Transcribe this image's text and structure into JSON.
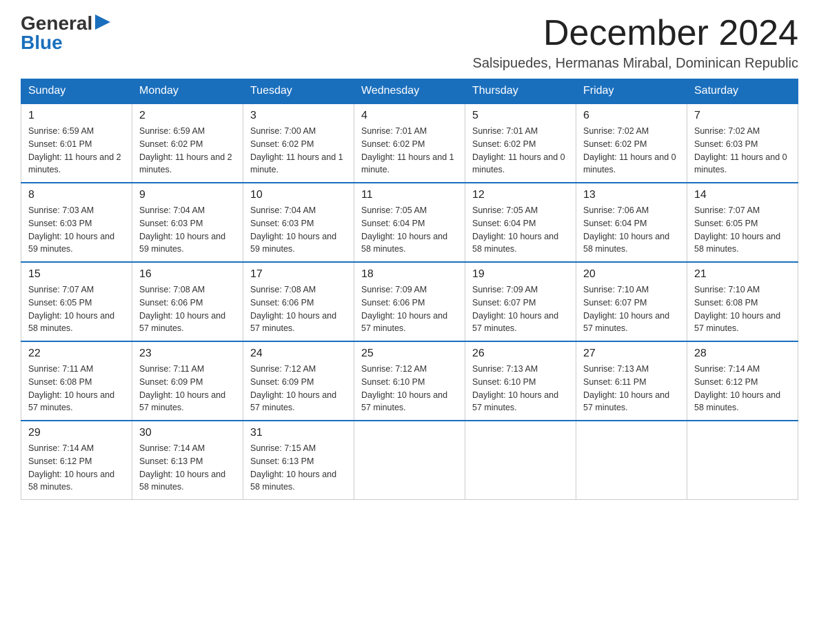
{
  "logo": {
    "general": "General",
    "blue": "Blue",
    "triangle": "▶"
  },
  "title": "December 2024",
  "subtitle": "Salsipuedes, Hermanas Mirabal, Dominican Republic",
  "headers": [
    "Sunday",
    "Monday",
    "Tuesday",
    "Wednesday",
    "Thursday",
    "Friday",
    "Saturday"
  ],
  "weeks": [
    [
      {
        "day": "1",
        "sunrise": "Sunrise: 6:59 AM",
        "sunset": "Sunset: 6:01 PM",
        "daylight": "Daylight: 11 hours and 2 minutes."
      },
      {
        "day": "2",
        "sunrise": "Sunrise: 6:59 AM",
        "sunset": "Sunset: 6:02 PM",
        "daylight": "Daylight: 11 hours and 2 minutes."
      },
      {
        "day": "3",
        "sunrise": "Sunrise: 7:00 AM",
        "sunset": "Sunset: 6:02 PM",
        "daylight": "Daylight: 11 hours and 1 minute."
      },
      {
        "day": "4",
        "sunrise": "Sunrise: 7:01 AM",
        "sunset": "Sunset: 6:02 PM",
        "daylight": "Daylight: 11 hours and 1 minute."
      },
      {
        "day": "5",
        "sunrise": "Sunrise: 7:01 AM",
        "sunset": "Sunset: 6:02 PM",
        "daylight": "Daylight: 11 hours and 0 minutes."
      },
      {
        "day": "6",
        "sunrise": "Sunrise: 7:02 AM",
        "sunset": "Sunset: 6:02 PM",
        "daylight": "Daylight: 11 hours and 0 minutes."
      },
      {
        "day": "7",
        "sunrise": "Sunrise: 7:02 AM",
        "sunset": "Sunset: 6:03 PM",
        "daylight": "Daylight: 11 hours and 0 minutes."
      }
    ],
    [
      {
        "day": "8",
        "sunrise": "Sunrise: 7:03 AM",
        "sunset": "Sunset: 6:03 PM",
        "daylight": "Daylight: 10 hours and 59 minutes."
      },
      {
        "day": "9",
        "sunrise": "Sunrise: 7:04 AM",
        "sunset": "Sunset: 6:03 PM",
        "daylight": "Daylight: 10 hours and 59 minutes."
      },
      {
        "day": "10",
        "sunrise": "Sunrise: 7:04 AM",
        "sunset": "Sunset: 6:03 PM",
        "daylight": "Daylight: 10 hours and 59 minutes."
      },
      {
        "day": "11",
        "sunrise": "Sunrise: 7:05 AM",
        "sunset": "Sunset: 6:04 PM",
        "daylight": "Daylight: 10 hours and 58 minutes."
      },
      {
        "day": "12",
        "sunrise": "Sunrise: 7:05 AM",
        "sunset": "Sunset: 6:04 PM",
        "daylight": "Daylight: 10 hours and 58 minutes."
      },
      {
        "day": "13",
        "sunrise": "Sunrise: 7:06 AM",
        "sunset": "Sunset: 6:04 PM",
        "daylight": "Daylight: 10 hours and 58 minutes."
      },
      {
        "day": "14",
        "sunrise": "Sunrise: 7:07 AM",
        "sunset": "Sunset: 6:05 PM",
        "daylight": "Daylight: 10 hours and 58 minutes."
      }
    ],
    [
      {
        "day": "15",
        "sunrise": "Sunrise: 7:07 AM",
        "sunset": "Sunset: 6:05 PM",
        "daylight": "Daylight: 10 hours and 58 minutes."
      },
      {
        "day": "16",
        "sunrise": "Sunrise: 7:08 AM",
        "sunset": "Sunset: 6:06 PM",
        "daylight": "Daylight: 10 hours and 57 minutes."
      },
      {
        "day": "17",
        "sunrise": "Sunrise: 7:08 AM",
        "sunset": "Sunset: 6:06 PM",
        "daylight": "Daylight: 10 hours and 57 minutes."
      },
      {
        "day": "18",
        "sunrise": "Sunrise: 7:09 AM",
        "sunset": "Sunset: 6:06 PM",
        "daylight": "Daylight: 10 hours and 57 minutes."
      },
      {
        "day": "19",
        "sunrise": "Sunrise: 7:09 AM",
        "sunset": "Sunset: 6:07 PM",
        "daylight": "Daylight: 10 hours and 57 minutes."
      },
      {
        "day": "20",
        "sunrise": "Sunrise: 7:10 AM",
        "sunset": "Sunset: 6:07 PM",
        "daylight": "Daylight: 10 hours and 57 minutes."
      },
      {
        "day": "21",
        "sunrise": "Sunrise: 7:10 AM",
        "sunset": "Sunset: 6:08 PM",
        "daylight": "Daylight: 10 hours and 57 minutes."
      }
    ],
    [
      {
        "day": "22",
        "sunrise": "Sunrise: 7:11 AM",
        "sunset": "Sunset: 6:08 PM",
        "daylight": "Daylight: 10 hours and 57 minutes."
      },
      {
        "day": "23",
        "sunrise": "Sunrise: 7:11 AM",
        "sunset": "Sunset: 6:09 PM",
        "daylight": "Daylight: 10 hours and 57 minutes."
      },
      {
        "day": "24",
        "sunrise": "Sunrise: 7:12 AM",
        "sunset": "Sunset: 6:09 PM",
        "daylight": "Daylight: 10 hours and 57 minutes."
      },
      {
        "day": "25",
        "sunrise": "Sunrise: 7:12 AM",
        "sunset": "Sunset: 6:10 PM",
        "daylight": "Daylight: 10 hours and 57 minutes."
      },
      {
        "day": "26",
        "sunrise": "Sunrise: 7:13 AM",
        "sunset": "Sunset: 6:10 PM",
        "daylight": "Daylight: 10 hours and 57 minutes."
      },
      {
        "day": "27",
        "sunrise": "Sunrise: 7:13 AM",
        "sunset": "Sunset: 6:11 PM",
        "daylight": "Daylight: 10 hours and 57 minutes."
      },
      {
        "day": "28",
        "sunrise": "Sunrise: 7:14 AM",
        "sunset": "Sunset: 6:12 PM",
        "daylight": "Daylight: 10 hours and 58 minutes."
      }
    ],
    [
      {
        "day": "29",
        "sunrise": "Sunrise: 7:14 AM",
        "sunset": "Sunset: 6:12 PM",
        "daylight": "Daylight: 10 hours and 58 minutes."
      },
      {
        "day": "30",
        "sunrise": "Sunrise: 7:14 AM",
        "sunset": "Sunset: 6:13 PM",
        "daylight": "Daylight: 10 hours and 58 minutes."
      },
      {
        "day": "31",
        "sunrise": "Sunrise: 7:15 AM",
        "sunset": "Sunset: 6:13 PM",
        "daylight": "Daylight: 10 hours and 58 minutes."
      },
      null,
      null,
      null,
      null
    ]
  ]
}
